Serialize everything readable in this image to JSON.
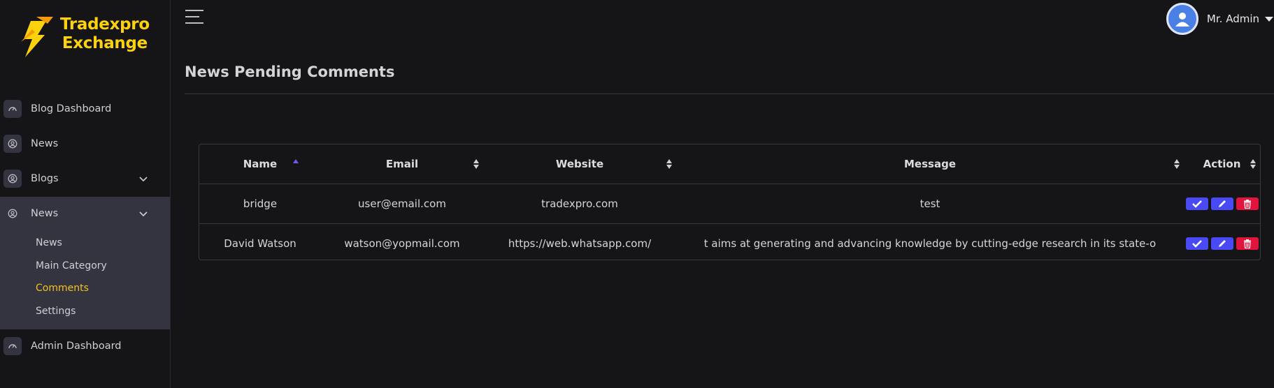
{
  "brand": {
    "line1": "Tradexpro",
    "line2": "Exchange"
  },
  "sidebar": {
    "items": [
      {
        "label": "Blog Dashboard",
        "icon": "gauge-icon"
      },
      {
        "label": "News",
        "icon": "user-circle-icon"
      },
      {
        "label": "Blogs",
        "icon": "user-circle-icon"
      },
      {
        "label": "News",
        "icon": "user-circle-icon"
      },
      {
        "label": "Admin Dashboard",
        "icon": "gauge-icon"
      }
    ],
    "submenu": [
      {
        "label": "News"
      },
      {
        "label": "Main Category"
      },
      {
        "label": "Comments"
      },
      {
        "label": "Settings"
      }
    ]
  },
  "header": {
    "user_name": "Mr. Admin"
  },
  "page": {
    "title": "News Pending Comments"
  },
  "table": {
    "columns": [
      "Name",
      "Email",
      "Website",
      "Message",
      "Action"
    ],
    "rows": [
      {
        "name": "bridge",
        "email": "user@email.com",
        "website": "tradexpro.com",
        "message": "test"
      },
      {
        "name": "David Watson",
        "email": "watson@yopmail.com",
        "website": "https://web.whatsapp.com/",
        "message": "t aims at generating and advancing knowledge by cutting-edge research in its state-o"
      }
    ]
  },
  "colors": {
    "accent": "#4a4af4",
    "danger": "#e0143c",
    "brand": "#fcd20f",
    "active": "#f6c21a"
  }
}
